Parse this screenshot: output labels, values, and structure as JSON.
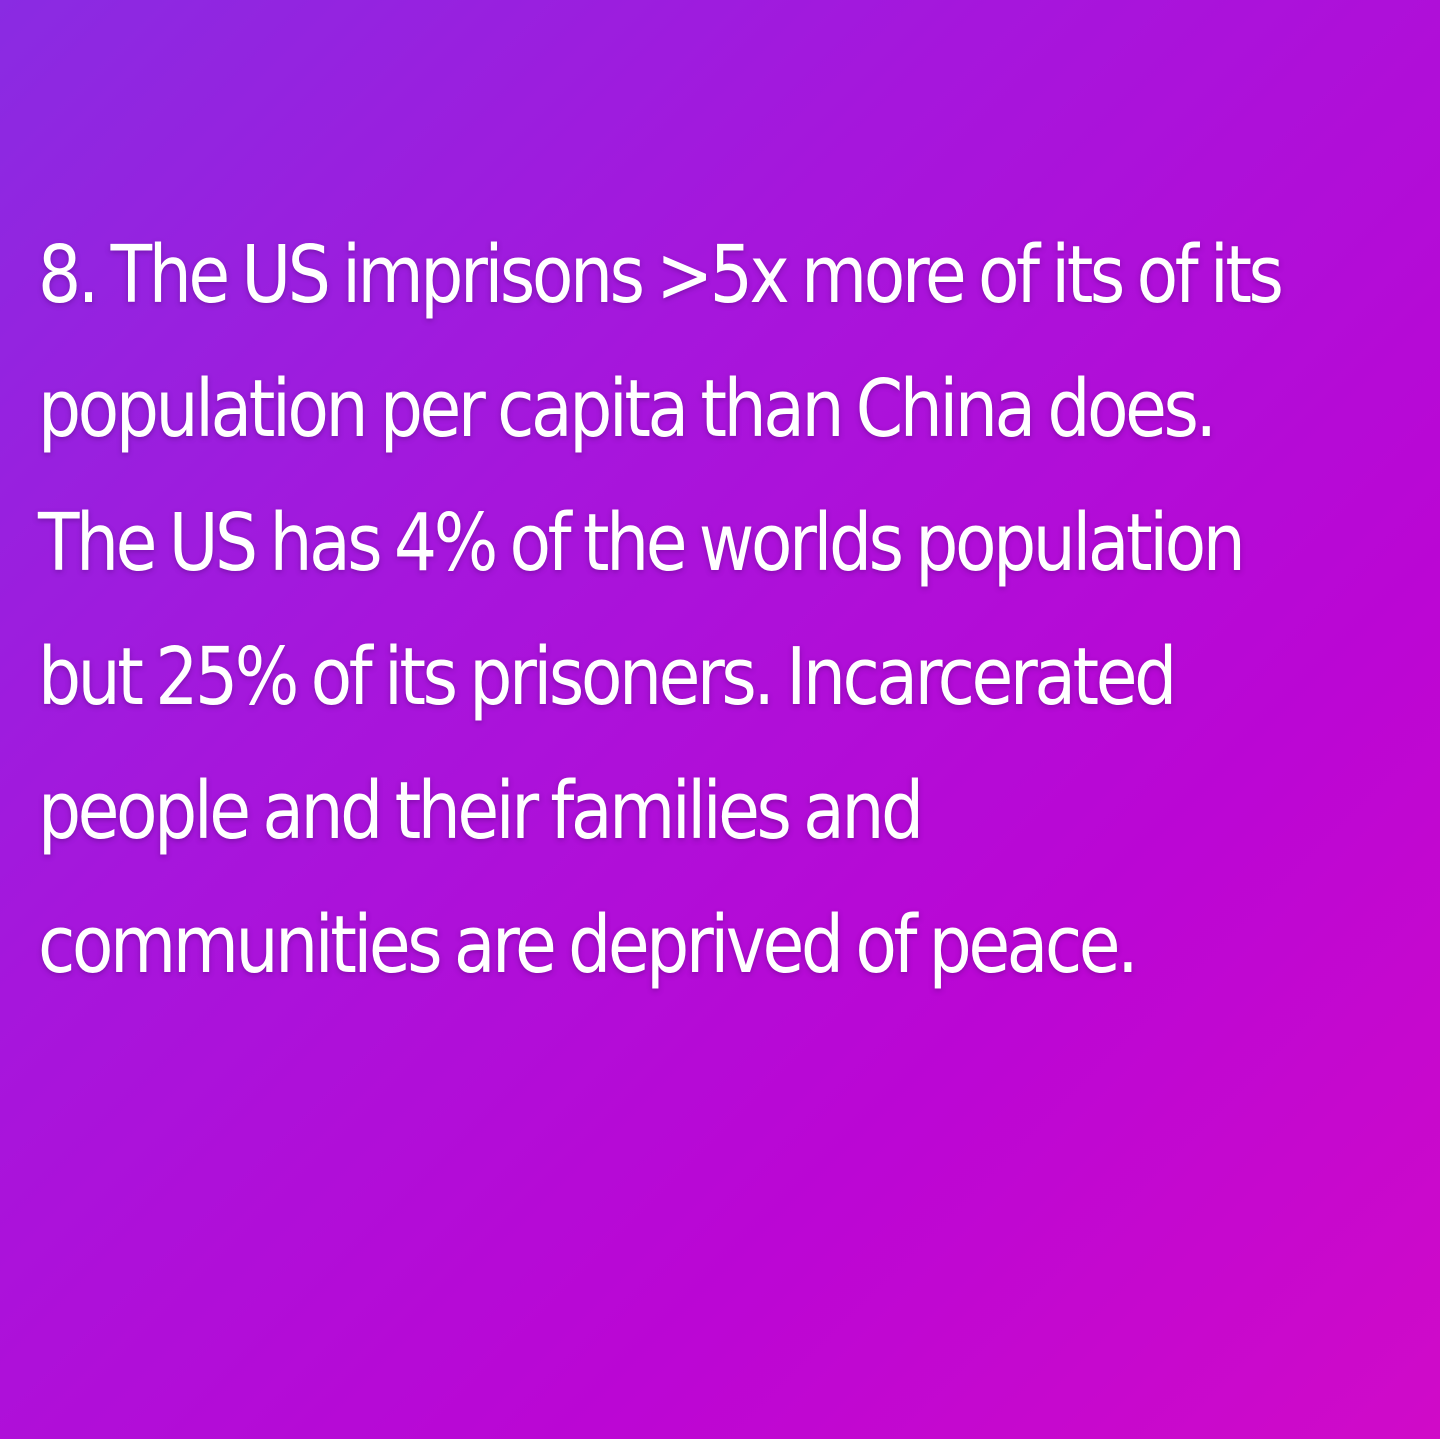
{
  "slide": {
    "background_colors": [
      "#8a2be2",
      "#a616dc",
      "#bb06d4",
      "#d00ac8"
    ],
    "text_color": "#ffffff",
    "lines": [
      "8. The US imprisons >5x more of its of its",
      "population per capita than China does.",
      "The US has 4% of the worlds population",
      "but 25% of its prisoners. Incarcerated",
      "people and their families and",
      "communities are deprived of peace."
    ]
  }
}
